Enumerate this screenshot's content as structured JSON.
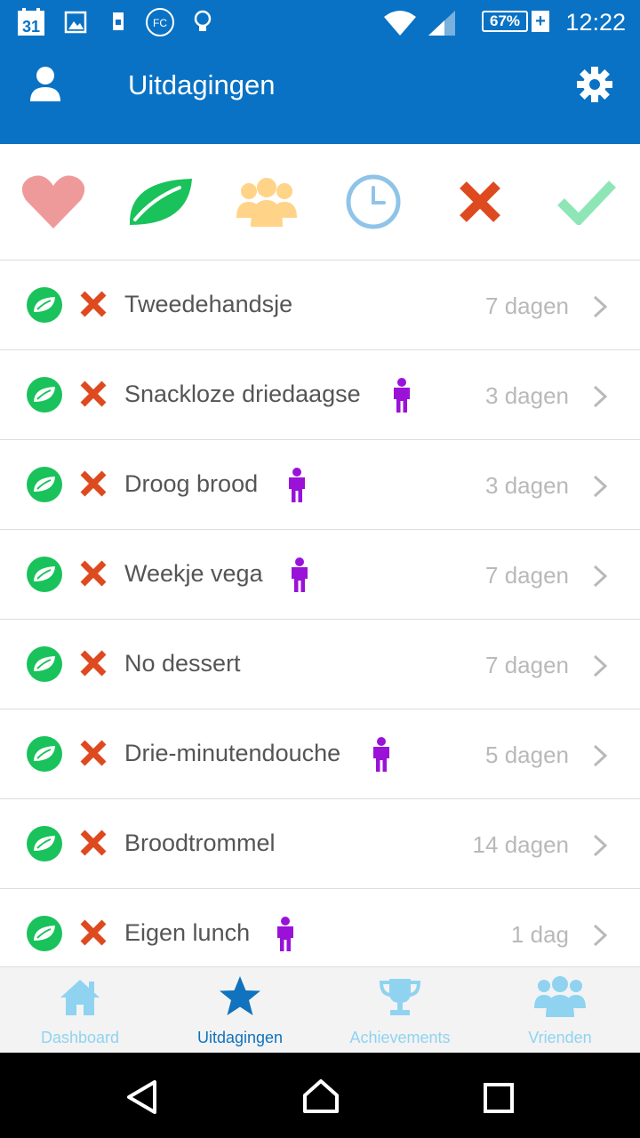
{
  "status_bar": {
    "calendar_day": "31",
    "fc_label": "FC",
    "battery": "67%",
    "battery_plus": "+",
    "time": "12:22"
  },
  "app_bar": {
    "title": "Uitdagingen",
    "profile_icon": "person-icon",
    "settings_icon": "gear-icon"
  },
  "filters": [
    {
      "icon": "heart-icon",
      "color": "#ef9a9a"
    },
    {
      "icon": "leaf-icon",
      "color": "#19c25a"
    },
    {
      "icon": "group-icon",
      "color": "#ffd488"
    },
    {
      "icon": "clock-icon",
      "color": "#8fc4e8"
    },
    {
      "icon": "x-icon",
      "color": "#de4a1f"
    },
    {
      "icon": "check-icon",
      "color": "#8ee6b6"
    }
  ],
  "challenges": [
    {
      "title": "Tweedehandsje",
      "duration": "7 dagen",
      "solo": false
    },
    {
      "title": "Snackloze driedaagse",
      "duration": "3 dagen",
      "solo": true
    },
    {
      "title": "Droog brood",
      "duration": "3 dagen",
      "solo": true
    },
    {
      "title": "Weekje vega",
      "duration": "7 dagen",
      "solo": true
    },
    {
      "title": "No dessert",
      "duration": "7 dagen",
      "solo": false
    },
    {
      "title": "Drie-minutendouche",
      "duration": "5 dagen",
      "solo": true
    },
    {
      "title": "Broodtrommel",
      "duration": "14 dagen",
      "solo": false
    },
    {
      "title": "Eigen lunch",
      "duration": "1 dag",
      "solo": true
    }
  ],
  "tabs": [
    {
      "label": "Dashboard",
      "icon": "home-icon",
      "active": false
    },
    {
      "label": "Uitdagingen",
      "icon": "star-icon",
      "active": true
    },
    {
      "label": "Achievements",
      "icon": "trophy-icon",
      "active": false
    },
    {
      "label": "Vrienden",
      "icon": "friends-icon",
      "active": false
    }
  ],
  "colors": {
    "primary": "#0a72c4",
    "leaf": "#19c25a",
    "cross": "#de4a1f",
    "person": "#9a12d8",
    "tab_active": "#1172bd",
    "tab_inactive": "#8fd3f0"
  }
}
